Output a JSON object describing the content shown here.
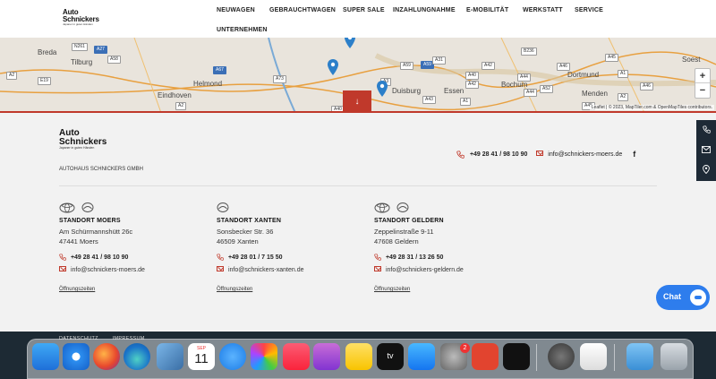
{
  "logo": {
    "line1": "Auto",
    "line2": "Schnickers",
    "tagline": "Japaner in guten Händen"
  },
  "nav": [
    {
      "label": "NEUWAGEN",
      "name": "nav-neuwagen"
    },
    {
      "label": "GEBRAUCHTWAGEN",
      "name": "nav-gebrauchtwagen"
    },
    {
      "label": "SUPER SALE",
      "name": "nav-super-sale"
    },
    {
      "label": "INZAHLUNGNAHME",
      "name": "nav-inzahlungnahme"
    },
    {
      "label": "E-MOBILITÄT",
      "name": "nav-e-mobilitaet"
    },
    {
      "label": "WERKSTATT",
      "name": "nav-werkstatt"
    },
    {
      "label": "SERVICE",
      "name": "nav-service"
    },
    {
      "label": "UNTERNEHMEN",
      "name": "nav-unternehmen"
    }
  ],
  "map": {
    "cities": [
      "Breda",
      "Tilburg",
      "Helmond",
      "Eindhoven",
      "Duisburg",
      "Essen",
      "Bochum",
      "Dortmund",
      "Menden",
      "Soest"
    ],
    "roads": [
      "A27",
      "N261",
      "A58",
      "A59",
      "A67",
      "A2",
      "E19",
      "A2",
      "A73",
      "A59",
      "A31",
      "A40",
      "A3",
      "B236",
      "A42",
      "A44",
      "A45",
      "A46",
      "A40",
      "A42",
      "A52",
      "A43",
      "A1",
      "A44",
      "A46",
      "A1",
      "A2",
      "A45"
    ],
    "zoom_in": "+",
    "zoom_out": "−",
    "attribution": "Leaflet | © 2023, MapTiler.com & OpenMapTiles contributors.",
    "down_button": "↓"
  },
  "footer": {
    "logo": {
      "line1": "Auto",
      "line2": "Schnickers",
      "tagline": "Japaner in guten Händen"
    },
    "company": "AUTOHAUS SCHNICKERS GMBH",
    "phone": "+49 28 41 / 98 10 90",
    "email": "info@schnickers-moers.de",
    "facebook": "f"
  },
  "locations": [
    {
      "title": "STANDORT MOERS",
      "street": "Am Schürmannshütt 26c",
      "city": "47441 Moers",
      "phone": "+49 28 41 / 98 10 90",
      "email": "info@schnickers-moers.de",
      "hours": "Öffnungszeiten"
    },
    {
      "title": "STANDORT XANTEN",
      "street": "Sonsbecker Str. 36",
      "city": "46509 Xanten",
      "phone": "+49 28 01 / 7 15 50",
      "email": "info@schnickers-xanten.de",
      "hours": "Öffnungszeiten"
    },
    {
      "title": "STANDORT GELDERN",
      "street": "Zeppelinstraße 9-11",
      "city": "47608 Geldern",
      "phone": "+49 28 31 / 13 26 50",
      "email": "info@schnickers-geldern.de",
      "hours": "Öffnungszeiten"
    }
  ],
  "sidebar": {
    "phone": "phone-icon",
    "mail": "mail-icon",
    "location": "location-icon"
  },
  "chat": {
    "label": "Chat"
  },
  "bottom": {
    "links": [
      "DATENSCHUTZ",
      "IMPRESSUM"
    ]
  },
  "dock": {
    "calendar_month": "SEP",
    "calendar_day": "11",
    "tv_label": "tv",
    "badge": "2",
    "colors": {
      "dock_bg": "#d2d7dc",
      "brand_red": "#c0392b",
      "chat_blue": "#2e7ded",
      "footer_dark": "#1d2a34"
    }
  }
}
